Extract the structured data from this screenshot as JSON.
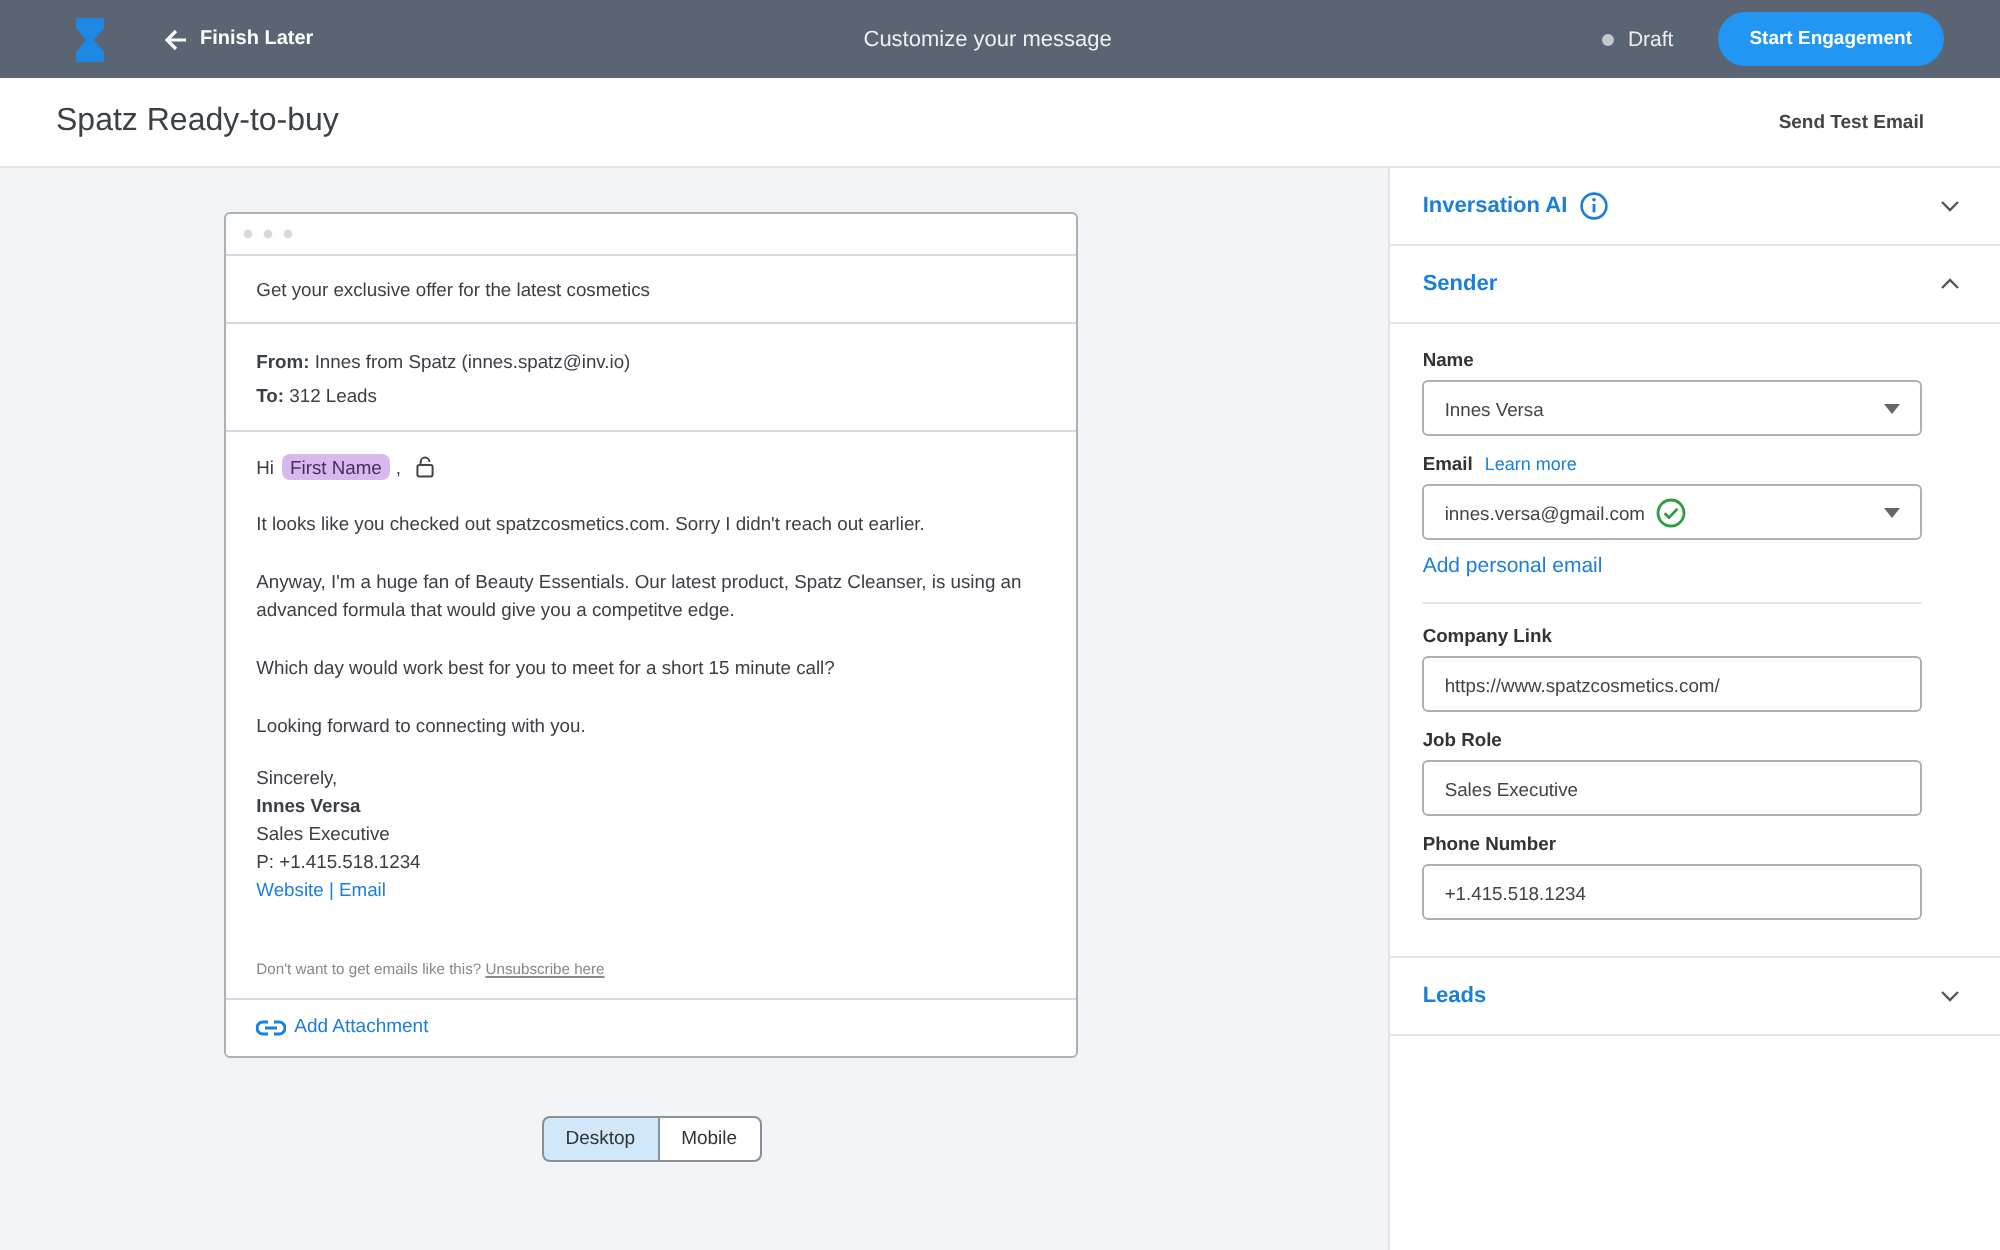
{
  "top_bar": {
    "back": "Finish Later",
    "title": "Customize your message",
    "status": "Draft",
    "primary_button": "Start Engagement"
  },
  "header": {
    "title": "Spatz Ready-to-buy",
    "action": "Send Test Email"
  },
  "email": {
    "subject": "Get your exclusive offer for the latest cosmetics",
    "from_label": "From:",
    "from": "Innes from Spatz (innes.spatz@inv.io)",
    "to_label": "To:",
    "to": "312 Leads",
    "greeting": "Hi",
    "token": "First Name",
    "greeting_end": ",",
    "paragraphs": [
      "It looks like you checked out spatzcosmetics.com. Sorry I didn't reach out earlier.",
      "Anyway, I'm a huge fan of Beauty Essentials. Our latest product, Spatz Cleanser, is using an advanced formula that would give you a competitve edge.",
      "Which day would work best for you to meet for a short 15 minute call?",
      "Looking forward to connecting with you."
    ],
    "closing": "Sincerely,",
    "signature_name": "Innes Versa",
    "signature_title": "Sales Executive",
    "signature_phone": "P: +1.415.518.1234",
    "links": [
      "Website",
      "Email"
    ],
    "links_separator": "|",
    "footer_text": "Don't want to get emails like this?",
    "footer_link": "Unsubscribe here",
    "attachment": "Add Attachment"
  },
  "view_toggle": [
    {
      "label": "Desktop",
      "selected": true
    },
    {
      "label": "Mobile",
      "selected": false
    }
  ],
  "sections": [
    {
      "title": "Inversation AI",
      "info": true,
      "expanded": false
    },
    {
      "title": "Sender",
      "expanded": true,
      "fields": [
        {
          "kind": "select",
          "label": "Name",
          "value": "Innes Versa"
        },
        {
          "kind": "select",
          "label": "Email",
          "label_link": "Learn more",
          "value": "innes.versa@gmail.com",
          "verified": true
        },
        {
          "kind": "link",
          "label": "Add personal email"
        },
        {
          "kind": "input",
          "label": "Company Link",
          "value": "https://www.spatzcosmetics.com/"
        },
        {
          "kind": "input",
          "label": "Job Role",
          "value": "Sales Executive"
        },
        {
          "kind": "input",
          "label": "Phone Number",
          "value": "+1.415.518.1234"
        }
      ]
    },
    {
      "title": "Leads",
      "expanded": false
    }
  ]
}
